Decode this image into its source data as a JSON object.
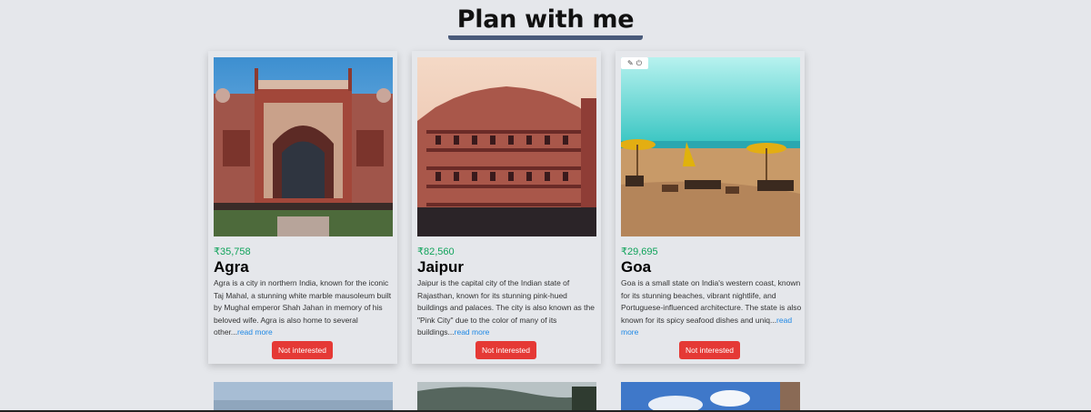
{
  "header": {
    "title": "Plan with me"
  },
  "cards": [
    {
      "price": "₹35,758",
      "name": "Agra",
      "description": "Agra is a city in northern India, known for the iconic Taj Mahal, a stunning white marble mausoleum built by Mughal emperor Shah Jahan in memory of his beloved wife. Agra is also home to several other...",
      "read_more": "read more",
      "button": "Not interested"
    },
    {
      "price": "₹82,560",
      "name": "Jaipur",
      "description": "Jaipur is the capital city of the Indian state of Rajasthan, known for its stunning pink-hued buildings and palaces. The city is also known as the \"Pink City\" due to the color of many of its buildings...",
      "read_more": "read more",
      "button": "Not interested"
    },
    {
      "price": "₹29,695",
      "name": "Goa",
      "description": "Goa is a small state on India's western coast, known for its stunning beaches, vibrant nightlife, and Portuguese-influenced architecture. The state is also known for its spicy seafood dishes and uniq...",
      "read_more": "read more",
      "button": "Not interested"
    }
  ],
  "colors": {
    "price": "#10a35b",
    "button": "#e53935",
    "link": "#1e88e5",
    "underline": "#4a5b7a"
  }
}
